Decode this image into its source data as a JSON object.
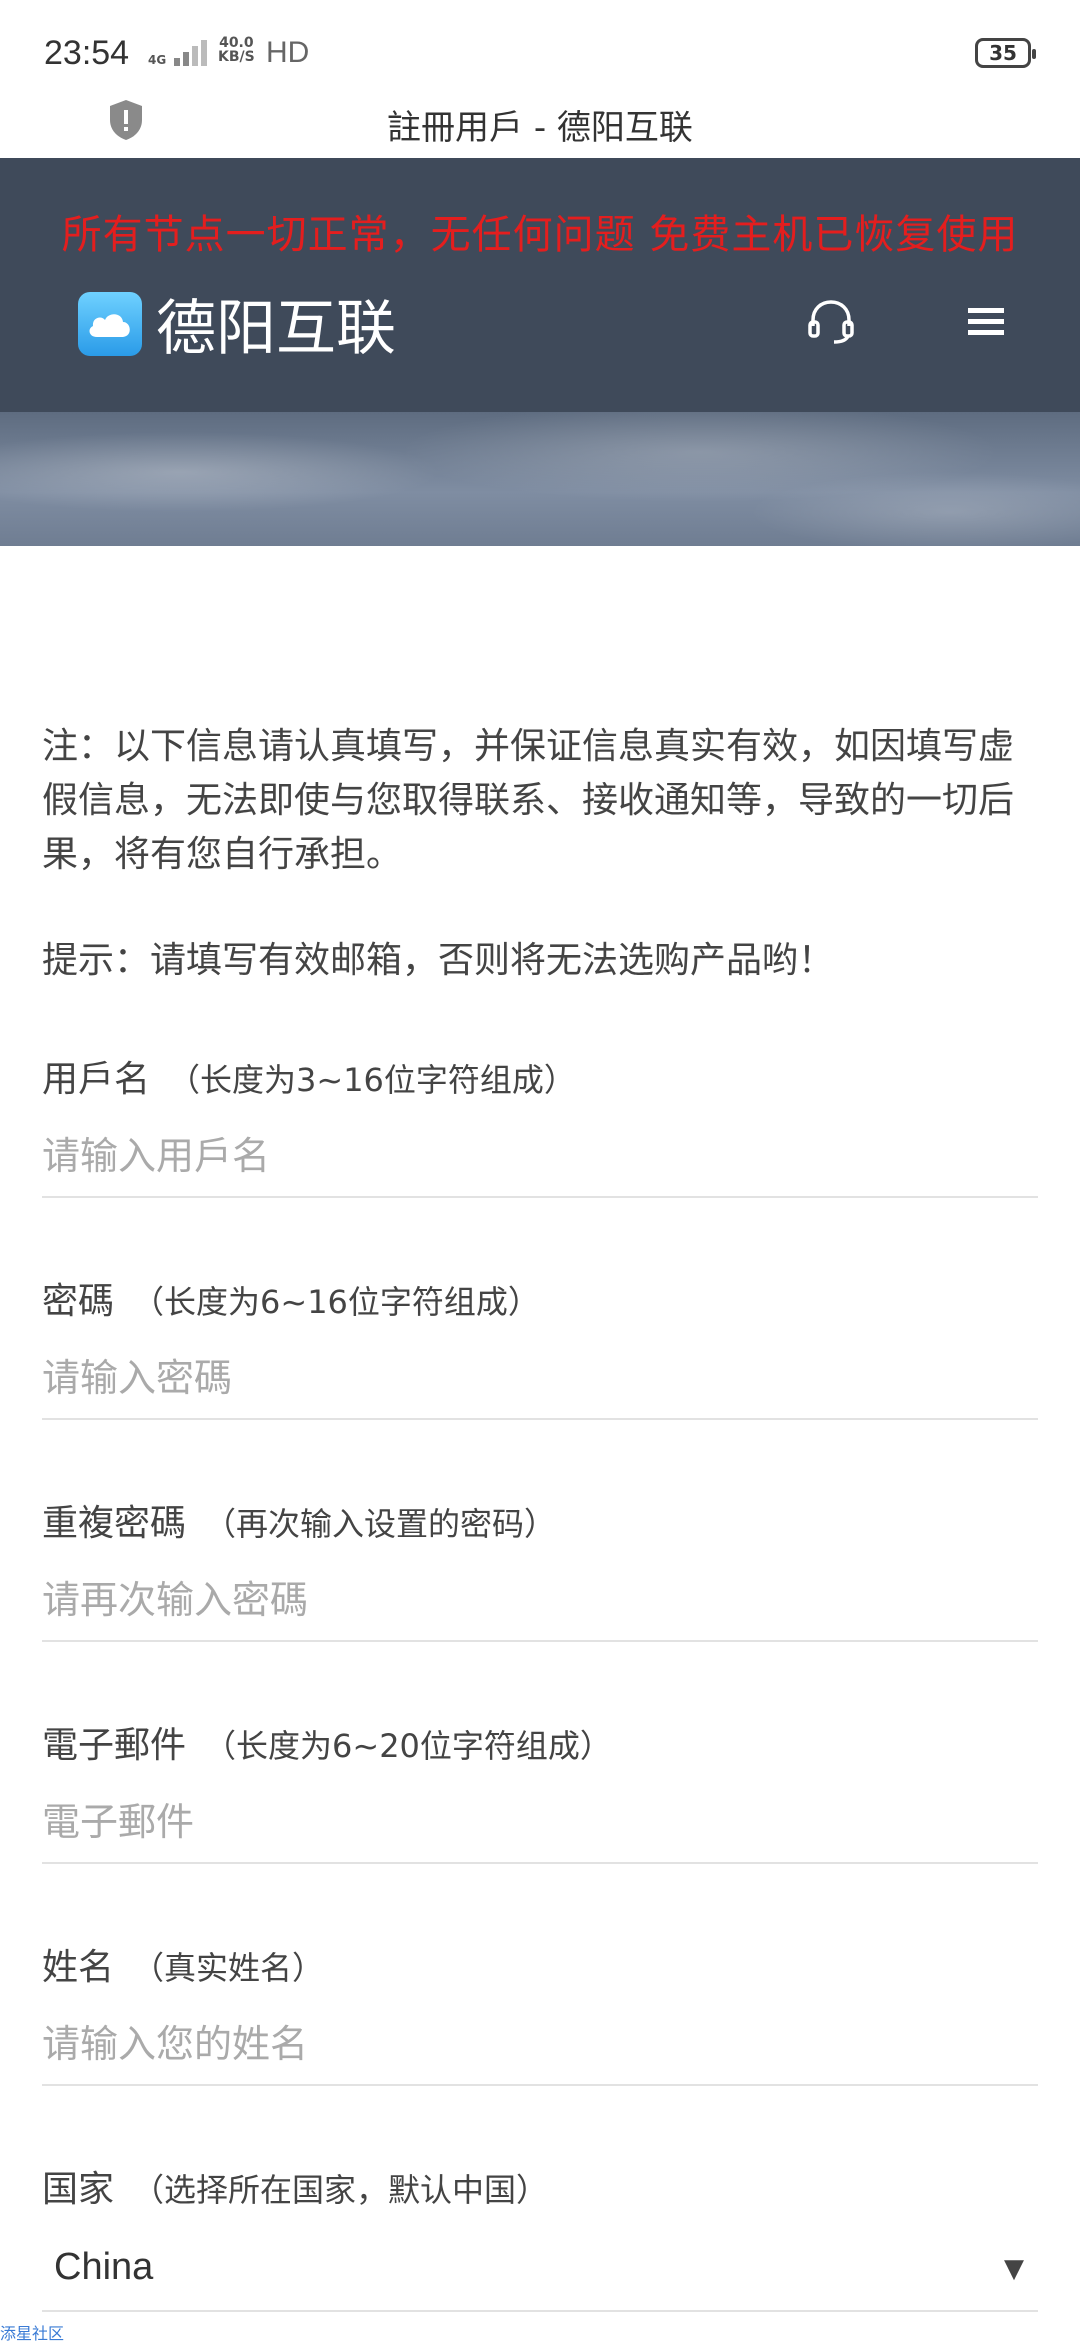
{
  "status_bar": {
    "time": "23:54",
    "network": "4G",
    "speed_value": "40.0",
    "speed_unit": "KB/S",
    "hd": "HD",
    "battery": "35"
  },
  "browser": {
    "page_title": "註冊用戶 - 德阳互联"
  },
  "header": {
    "notice": "所有节点一切正常，无任何问题 免费主机已恢复使用",
    "logo_text": "德阳互联",
    "colors": {
      "background": "#3f4a5a",
      "notice": "#e41e1e"
    }
  },
  "content": {
    "note": "注：以下信息请认真填写，并保证信息真实有效，如因填写虚假信息，无法即使与您取得联系、接收通知等，导致的一切后果，将有您自行承担。",
    "tip": "提示：请填写有效邮箱，否则将无法选购产品哟！"
  },
  "form": {
    "username": {
      "label": "用戶名",
      "hint": "（长度为3~16位字符组成）",
      "placeholder": "请输入用戶名"
    },
    "password": {
      "label": "密碼",
      "hint": "（长度为6~16位字符组成）",
      "placeholder": "请输入密碼"
    },
    "confirm_password": {
      "label": "重複密碼",
      "hint": "（再次输入设置的密码）",
      "placeholder": "请再次输入密碼"
    },
    "email": {
      "label": "電子郵件",
      "hint": "（长度为6~20位字符组成）",
      "placeholder": "電子郵件"
    },
    "name": {
      "label": "姓名",
      "hint": "（真实姓名）",
      "placeholder": "请输入您的姓名"
    },
    "country": {
      "label": "国家",
      "hint": "（选择所在国家，默认中国）",
      "value": "China"
    }
  },
  "watermark": "添星社区"
}
